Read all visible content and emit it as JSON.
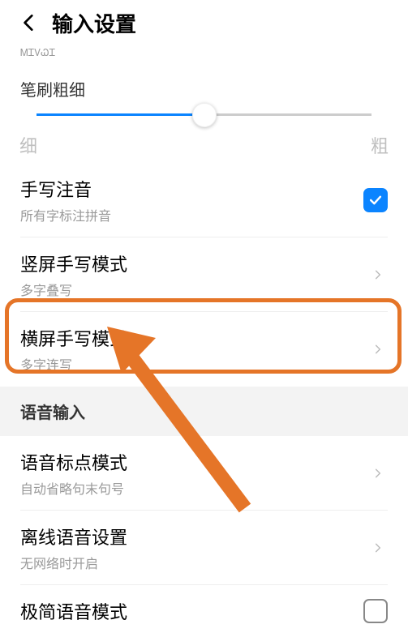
{
  "header": {
    "title": "输入设置"
  },
  "topCut": "ᎷᏆᏙᏇᏆ",
  "brush": {
    "label": "笔刷粗细",
    "thin": "细",
    "thick": "粗"
  },
  "items": {
    "handwritingPinyin": {
      "title": "手写注音",
      "sub": "所有字标注拼音"
    },
    "portraitMode": {
      "title": "竖屏手写模式",
      "sub": "多字叠写"
    },
    "landscapeMode": {
      "title": "横屏手写模式",
      "sub": "多字连写"
    }
  },
  "voiceSection": "语音输入",
  "voice": {
    "punctuation": {
      "title": "语音标点模式",
      "sub": "自动省略句末句号"
    },
    "offline": {
      "title": "离线语音设置",
      "sub": "无网络时开启"
    },
    "minimal": {
      "title": "极简语音模式"
    }
  }
}
